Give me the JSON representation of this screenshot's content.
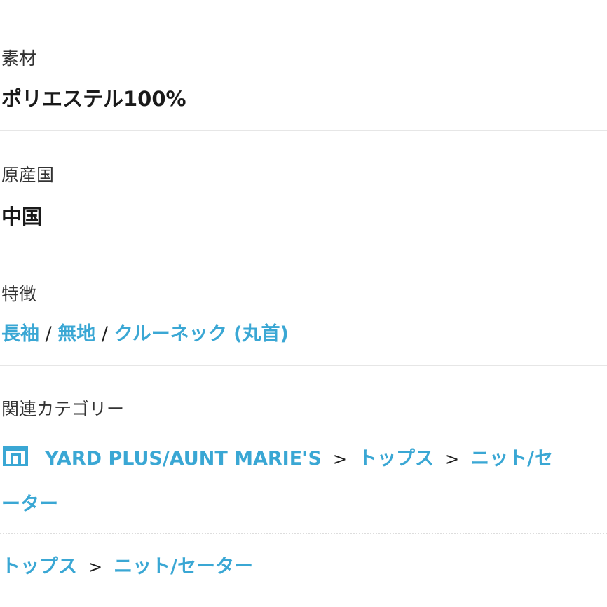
{
  "material": {
    "label": "素材",
    "value": "ポリエステル100%"
  },
  "origin": {
    "label": "原産国",
    "value": "中国"
  },
  "features": {
    "label": "特徴",
    "items": [
      "長袖",
      "無地",
      "クルーネック (丸首)"
    ],
    "separator": "/"
  },
  "related_categories": {
    "label": "関連カテゴリー",
    "breadcrumb_1": {
      "icon": "shop-icon",
      "items": [
        "YARD PLUS/AUNT MARIE'S",
        "トップス",
        "ニット/セ",
        "ーター"
      ]
    },
    "breadcrumb_2": {
      "items": [
        "トップス",
        "ニット/セーター"
      ]
    },
    "chevron": ">"
  },
  "colors": {
    "link": "#3aa7d4",
    "divider": "#e6e6e6"
  }
}
